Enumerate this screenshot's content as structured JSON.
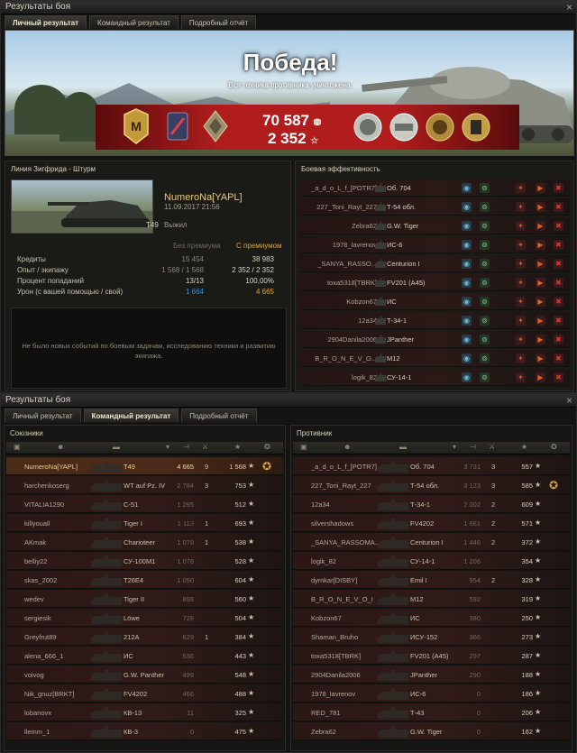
{
  "window1": {
    "title": "Результаты боя",
    "close": "×",
    "tabs": [
      {
        "label": "Личный результат",
        "active": true
      },
      {
        "label": "Командный результат",
        "active": false
      },
      {
        "label": "Подробный отчёт",
        "active": false
      }
    ]
  },
  "banner": {
    "result": "Победа!",
    "subtitle": "Вся техника противника уничтожена.",
    "credits": "70 587",
    "experience": "2 352",
    "rank_badge": "М",
    "credit_icon": "coins-icon",
    "exp_icon": "star-icon"
  },
  "personal": {
    "map": "Линия Зигфрида - Штурм",
    "player": "NumeroNa[YAPL]",
    "datetime": "11.09.2017 21:56",
    "tank": "T49",
    "status": "Выжил",
    "col_no_premium": "Без премиума",
    "col_premium": "С премиумом",
    "rows": [
      {
        "label": "Кредиты",
        "a": "15 454",
        "b": "38 983",
        "icon": "coins-icon"
      },
      {
        "label": "Опыт / экипажу",
        "a": "1 568 / 1 568",
        "b": "2 352 / 2 352",
        "icon": "star-icon"
      },
      {
        "label": "Процент попаданий",
        "a": "13/13",
        "b": "100,00%",
        "icon": ""
      },
      {
        "label": "Урон (с вашей помощью / свой)",
        "a": "1 664",
        "b": "4 665",
        "icon": ""
      }
    ],
    "events_message": "Не было новых событий по боевым задачам, исследованию техники и развитию экипажа."
  },
  "efficiency": {
    "title": "Боевая эффективность",
    "rows": [
      {
        "name": "_a_d_o_L_f_[POTR7]",
        "tank": "Об. 704"
      },
      {
        "name": "227_Toni_Rayt_227",
        "tank": "Т-54 обл."
      },
      {
        "name": "Zebra62",
        "tank": "G.W. Tiger"
      },
      {
        "name": "1978_lavrenov",
        "tank": "ИС-6"
      },
      {
        "name": "_SANYA_RASSO...",
        "tank": "Centurion I"
      },
      {
        "name": "toxa5318[TBRK]",
        "tank": "FV201 (A45)"
      },
      {
        "name": "Kobzon67",
        "tank": "ИС"
      },
      {
        "name": "12a34",
        "tank": "Т-34-1"
      },
      {
        "name": "2904Danila2006",
        "tank": "JPanther"
      },
      {
        "name": "B_R_O_N_E_V_O...",
        "tank": "M12"
      },
      {
        "name": "logik_82",
        "tank": "СУ-14-1"
      }
    ]
  },
  "window2": {
    "title": "Результаты боя",
    "close": "×",
    "tabs": [
      {
        "label": "Личный результат",
        "active": false
      },
      {
        "label": "Командный результат",
        "active": true
      },
      {
        "label": "Подробный отчёт",
        "active": false
      }
    ]
  },
  "allies": {
    "title": "Союзники",
    "rows": [
      {
        "name": "NumeroNa[YAPL]",
        "tank": "T49",
        "dmg": "4 665",
        "kills": "9",
        "xp": "1 568",
        "me": true,
        "medal": true
      },
      {
        "name": "harchenkoserg",
        "tank": "WT auf Pz. IV",
        "dmg": "2 784",
        "kills": "3",
        "xp": "753"
      },
      {
        "name": "VITALIA1290",
        "tank": "С-51",
        "dmg": "1 295",
        "kills": "",
        "xp": "512"
      },
      {
        "name": "killyouall",
        "tank": "Tiger I",
        "dmg": "1 113",
        "kills": "1",
        "xp": "693"
      },
      {
        "name": "AKmak",
        "tank": "Charioteer",
        "dmg": "1 078",
        "kills": "1",
        "xp": "538"
      },
      {
        "name": "belliy22",
        "tank": "СУ-100М1",
        "dmg": "1 078",
        "kills": "",
        "xp": "528"
      },
      {
        "name": "skas_2002",
        "tank": "T26E4",
        "dmg": "1 050",
        "kills": "",
        "xp": "604"
      },
      {
        "name": "wedev",
        "tank": "Tiger II",
        "dmg": "898",
        "kills": "",
        "xp": "560"
      },
      {
        "name": "sergiesik",
        "tank": "Löwe",
        "dmg": "728",
        "kills": "",
        "xp": "504"
      },
      {
        "name": "Greyfrut89",
        "tank": "212A",
        "dmg": "629",
        "kills": "1",
        "xp": "384"
      },
      {
        "name": "alena_666_1",
        "tank": "ИС",
        "dmg": "536",
        "kills": "",
        "xp": "443"
      },
      {
        "name": "voivog",
        "tank": "G.W. Panther",
        "dmg": "499",
        "kills": "",
        "xp": "548"
      },
      {
        "name": "Nik_gnuz[BRKT]",
        "tank": "FV4202",
        "dmg": "466",
        "kills": "",
        "xp": "488"
      },
      {
        "name": "lobanovx",
        "tank": "КВ-13",
        "dmg": "11",
        "kills": "",
        "xp": "325"
      },
      {
        "name": "llemm_1",
        "tank": "КВ-3",
        "dmg": "0",
        "kills": "",
        "xp": "475"
      }
    ]
  },
  "enemies": {
    "title": "Противник",
    "rows": [
      {
        "name": "_a_d_o_L_f_[POTR7]",
        "tank": "Об. 704",
        "dmg": "3 731",
        "kills": "3",
        "xp": "557"
      },
      {
        "name": "227_Toni_Rayt_227",
        "tank": "Т-54 обл.",
        "dmg": "3 123",
        "kills": "3",
        "xp": "585",
        "medal": true
      },
      {
        "name": "12a34",
        "tank": "Т-34-1",
        "dmg": "2 002",
        "kills": "2",
        "xp": "609"
      },
      {
        "name": "silvershadows",
        "tank": "FV4202",
        "dmg": "1 661",
        "kills": "2",
        "xp": "571"
      },
      {
        "name": "_SANYA_RASSOMA...",
        "tank": "Centurion I",
        "dmg": "1 446",
        "kills": "2",
        "xp": "372"
      },
      {
        "name": "logik_82",
        "tank": "СУ-14-1",
        "dmg": "1 206",
        "kills": "",
        "xp": "354"
      },
      {
        "name": "dymkar[DISBY]",
        "tank": "Emil I",
        "dmg": "954",
        "kills": "2",
        "xp": "328"
      },
      {
        "name": "B_R_O_N_E_V_O_I",
        "tank": "M12",
        "dmg": "592",
        "kills": "",
        "xp": "319"
      },
      {
        "name": "Kobzon67",
        "tank": "ИС",
        "dmg": "380",
        "kills": "",
        "xp": "250"
      },
      {
        "name": "Shaman_Bruho",
        "tank": "ИСУ-152",
        "dmg": "366",
        "kills": "",
        "xp": "273"
      },
      {
        "name": "toxa5318[TBRK]",
        "tank": "FV201 (A45)",
        "dmg": "297",
        "kills": "",
        "xp": "287"
      },
      {
        "name": "2904Danila2006",
        "tank": "JPanther",
        "dmg": "290",
        "kills": "",
        "xp": "188"
      },
      {
        "name": "1978_lavrenov",
        "tank": "ИС-6",
        "dmg": "0",
        "kills": "",
        "xp": "186"
      },
      {
        "name": "RED_781",
        "tank": "Т-43",
        "dmg": "0",
        "kills": "",
        "xp": "206"
      },
      {
        "name": "Zebra62",
        "tank": "G.W. Tiger",
        "dmg": "0",
        "kills": "",
        "xp": "162"
      }
    ]
  }
}
